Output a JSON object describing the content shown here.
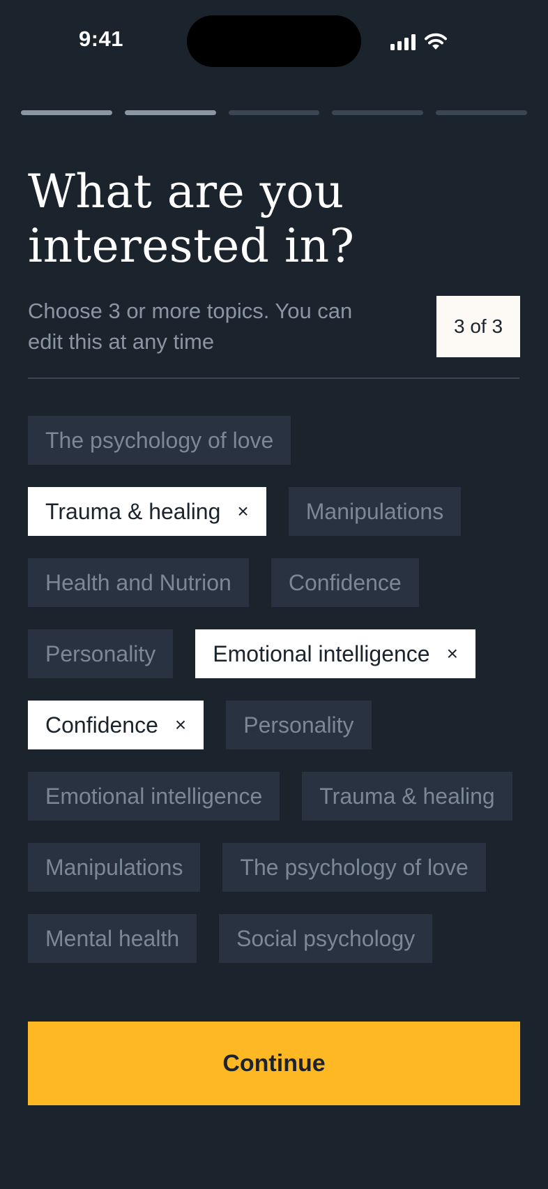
{
  "status_bar": {
    "time": "9:41"
  },
  "progress": {
    "total_steps": 5,
    "completed_steps": 2
  },
  "header": {
    "title": "What are you interested in?",
    "subtitle": "Choose 3 or more topics. You can edit this at any time",
    "counter": "3 of 3"
  },
  "chips": [
    {
      "label": "The psychology of love",
      "selected": false
    },
    {
      "label": "Trauma & healing",
      "selected": true
    },
    {
      "label": "Manipulations",
      "selected": false
    },
    {
      "label": "Health and Nutrion",
      "selected": false
    },
    {
      "label": "Confidence",
      "selected": false
    },
    {
      "label": "Personality",
      "selected": false
    },
    {
      "label": "Emotional intelligence",
      "selected": true
    },
    {
      "label": "Confidence",
      "selected": true
    },
    {
      "label": "Personality",
      "selected": false
    },
    {
      "label": "Emotional intelligence",
      "selected": false
    },
    {
      "label": "Trauma & healing",
      "selected": false
    },
    {
      "label": "Manipulations",
      "selected": false
    },
    {
      "label": "The psychology of love",
      "selected": false
    },
    {
      "label": "Mental health",
      "selected": false
    },
    {
      "label": "Social psychology",
      "selected": false
    }
  ],
  "remove_glyph": "×",
  "continue_label": "Continue",
  "colors": {
    "background": "#1b232d",
    "chip": "#283240",
    "chip_text": "#7c8896",
    "selected_chip": "#ffffff",
    "accent": "#fdb824"
  }
}
